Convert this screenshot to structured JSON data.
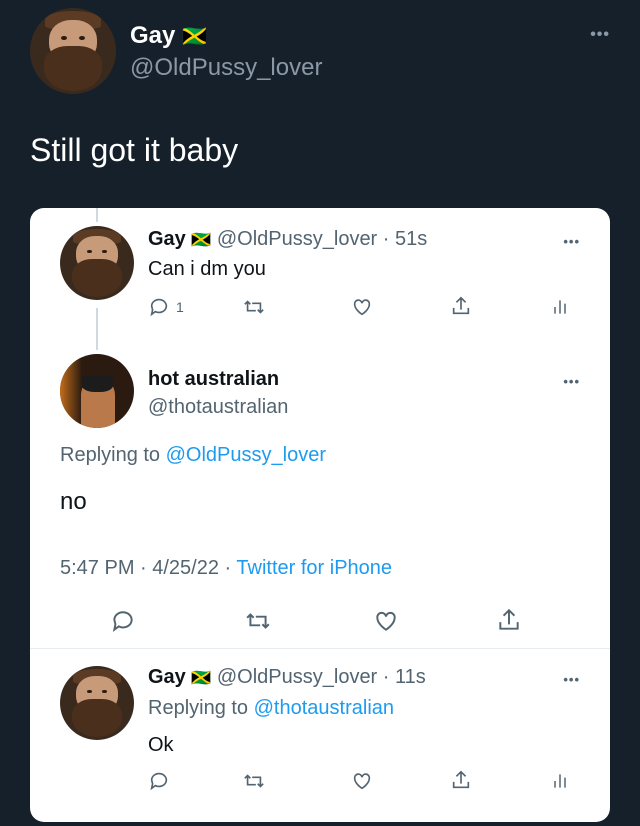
{
  "main_tweet": {
    "name": "Gay",
    "flag": "🇯🇲",
    "handle": "@OldPussy_lover",
    "text": "Still got it baby"
  },
  "embedded": {
    "tweet1": {
      "name": "Gay",
      "flag": "🇯🇲",
      "handle": "@OldPussy_lover",
      "time": "· 51s",
      "text": "Can i dm you",
      "reply_count": "1"
    },
    "tweet2": {
      "name": "hot australian",
      "handle": "@thotaustralian",
      "replying_prefix": "Replying to",
      "replying_to": "@OldPussy_lover",
      "text": "no",
      "timestamp": "5:47 PM · 4/25/22 · ",
      "source": "Twitter for iPhone"
    },
    "tweet3": {
      "name": "Gay",
      "flag": "🇯🇲",
      "handle": "@OldPussy_lover",
      "time": "· 11s",
      "replying_prefix": "Replying to",
      "replying_to": "@thotaustralian",
      "text": "Ok"
    }
  },
  "icons": [
    "more-icon",
    "reply-icon",
    "retweet-icon",
    "like-icon",
    "share-icon",
    "analytics-icon"
  ],
  "colors": {
    "background": "#15202b",
    "link": "#1d9bf0",
    "secondary": "#536471"
  }
}
